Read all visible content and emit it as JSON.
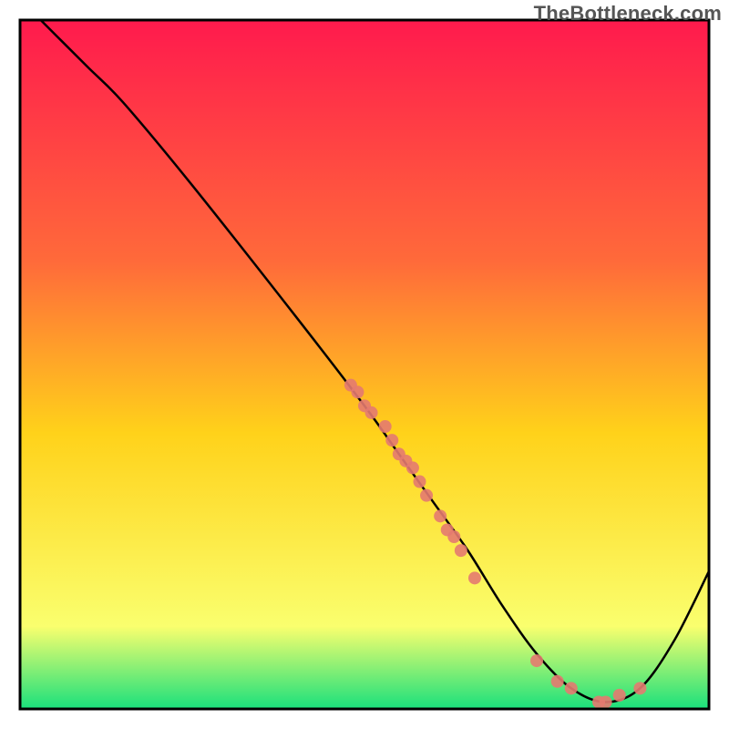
{
  "watermark": "TheBottleneck.com",
  "chart_data": {
    "type": "line",
    "title": "",
    "xlabel": "",
    "ylabel": "",
    "xlim": [
      0,
      100
    ],
    "ylim": [
      0,
      100
    ],
    "grid": false,
    "gradient_top": "#ff1a4d",
    "gradient_upper_mid": "#ff6a3a",
    "gradient_mid": "#ffd21a",
    "gradient_low": "#faff6e",
    "gradient_bottom": "#19e07c",
    "series": [
      {
        "name": "bottleneck-curve",
        "color": "#000000",
        "x": [
          3,
          6,
          10,
          15,
          25,
          40,
          50,
          55,
          60,
          65,
          70,
          75,
          80,
          85,
          90,
          95,
          100
        ],
        "y": [
          100,
          97,
          93,
          88,
          76,
          57,
          44,
          37,
          30,
          23,
          15,
          8,
          3,
          1,
          3,
          10,
          20
        ]
      }
    ],
    "points": {
      "name": "highlight-points",
      "color": "#e47a70",
      "radius": 7,
      "xy": [
        [
          48,
          47
        ],
        [
          49,
          46
        ],
        [
          50,
          44
        ],
        [
          51,
          43
        ],
        [
          53,
          41
        ],
        [
          54,
          39
        ],
        [
          55,
          37
        ],
        [
          56,
          36
        ],
        [
          57,
          35
        ],
        [
          58,
          33
        ],
        [
          59,
          31
        ],
        [
          61,
          28
        ],
        [
          62,
          26
        ],
        [
          63,
          25
        ],
        [
          64,
          23
        ],
        [
          66,
          19
        ],
        [
          75,
          7
        ],
        [
          78,
          4
        ],
        [
          80,
          3
        ],
        [
          84,
          1
        ],
        [
          85,
          1
        ],
        [
          87,
          2
        ],
        [
          90,
          3
        ]
      ]
    }
  }
}
